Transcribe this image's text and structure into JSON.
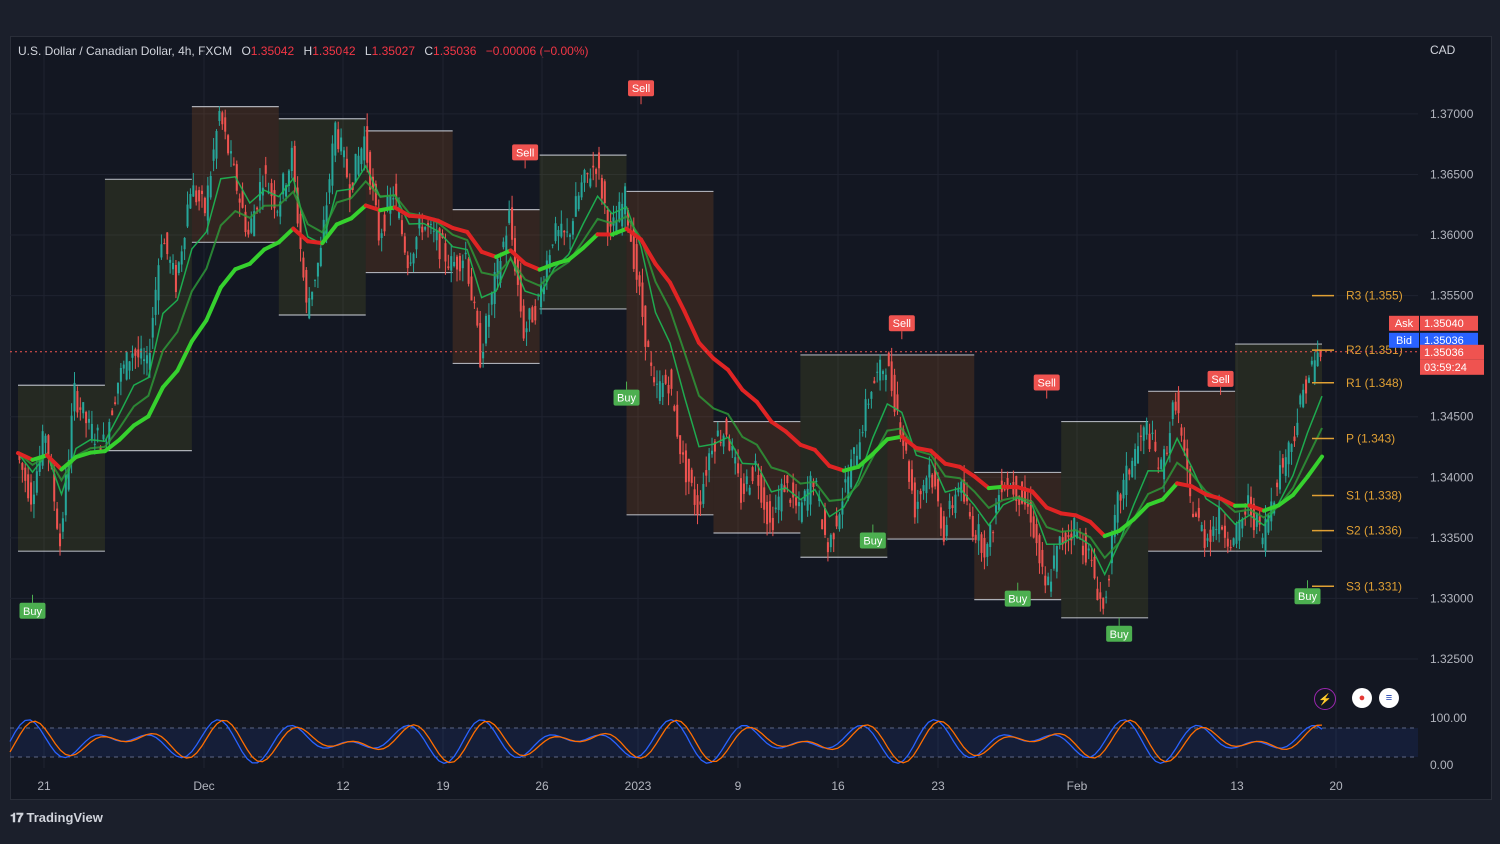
{
  "header": {
    "symbol": "U.S. Dollar / Canadian Dollar, 4h, FXCM",
    "o_label": "O",
    "o_value": "1.35042",
    "h_label": "H",
    "h_value": "1.35042",
    "l_label": "L",
    "l_value": "1.35027",
    "c_label": "C",
    "c_value": "1.35036",
    "change": "−0.00006 (−0.00%)"
  },
  "currency": "CAD",
  "brand": "TradingView",
  "colors": {
    "up": "#26a69a",
    "down": "#ef5350",
    "buy": "#4caf50",
    "sell": "#ef5350",
    "pivot": "#e0a034"
  },
  "chart_data": {
    "type": "line",
    "y_ticks": [
      "1.37000",
      "1.36500",
      "1.36000",
      "1.35500",
      "1.34500",
      "1.34000",
      "1.33500",
      "1.33000",
      "1.32500"
    ],
    "ylim": [
      1.3212,
      1.3728
    ],
    "x_ticks": [
      "21",
      "Dec",
      "12",
      "19",
      "26",
      "2023",
      "9",
      "16",
      "23",
      "Feb",
      "13",
      "20"
    ],
    "series": [
      {
        "points": [
          1.342,
          1.3385,
          1.3438,
          1.3345,
          1.347,
          1.344,
          1.3428,
          1.348,
          1.3505,
          1.349,
          1.36,
          1.356,
          1.364,
          1.362,
          1.37,
          1.365,
          1.36,
          1.365,
          1.3625,
          1.3665,
          1.354,
          1.3585,
          1.369,
          1.364,
          1.368,
          1.36,
          1.3635,
          1.358,
          1.361,
          1.3595,
          1.3575,
          1.3585,
          1.35,
          1.356,
          1.3615,
          1.352,
          1.3545,
          1.36,
          1.3598,
          1.364,
          1.366,
          1.36,
          1.363,
          1.355,
          1.347,
          1.348,
          1.3412,
          1.3375,
          1.343,
          1.344,
          1.3385,
          1.341,
          1.336,
          1.3395,
          1.337,
          1.34,
          1.334,
          1.3385,
          1.3425,
          1.3475,
          1.3495,
          1.3445,
          1.3375,
          1.341,
          1.3355,
          1.3395,
          1.336,
          1.334,
          1.3398,
          1.339,
          1.337,
          1.3305,
          1.3345,
          1.336,
          1.3335,
          1.329,
          1.3378,
          1.3415,
          1.344,
          1.3405,
          1.3465,
          1.338,
          1.335,
          1.3365,
          1.3345,
          1.3378,
          1.335,
          1.34,
          1.343,
          1.348,
          1.3504
        ]
      }
    ],
    "signals": [
      {
        "type": "Buy",
        "x": 1,
        "y": 1.3303
      },
      {
        "type": "Sell",
        "x": 35,
        "y": 1.3655
      },
      {
        "type": "Sell",
        "x": 43,
        "y": 1.3708
      },
      {
        "type": "Buy",
        "x": 42,
        "y": 1.3479
      },
      {
        "type": "Buy",
        "x": 59,
        "y": 1.3361
      },
      {
        "type": "Sell",
        "x": 61,
        "y": 1.3514
      },
      {
        "type": "Buy",
        "x": 69,
        "y": 1.3313
      },
      {
        "type": "Sell",
        "x": 71,
        "y": 1.3465
      },
      {
        "type": "Buy",
        "x": 76,
        "y": 1.3284
      },
      {
        "type": "Sell",
        "x": 83,
        "y": 1.3468
      },
      {
        "type": "Buy",
        "x": 89,
        "y": 1.3315
      }
    ],
    "pivots": [
      {
        "label": "R3 (1.355)",
        "value": 1.355
      },
      {
        "label": "R2 (1.351)",
        "value": 1.3505
      },
      {
        "label": "R1 (1.348)",
        "value": 1.3478
      },
      {
        "label": "P (1.343)",
        "value": 1.3432
      },
      {
        "label": "S1 (1.338)",
        "value": 1.3385
      },
      {
        "label": "S2 (1.336)",
        "value": 1.3356
      },
      {
        "label": "S3 (1.331)",
        "value": 1.331
      }
    ],
    "price_boxes": {
      "ask_label": "Ask",
      "ask_value": "1.35040",
      "bid_label": "Bid",
      "bid_value": "1.35036",
      "last_value": "1.35036",
      "countdown": "03:59:24",
      "last": 1.35036
    },
    "oscillator": {
      "top_label": "100.00",
      "bottom_label": "0.00"
    }
  }
}
